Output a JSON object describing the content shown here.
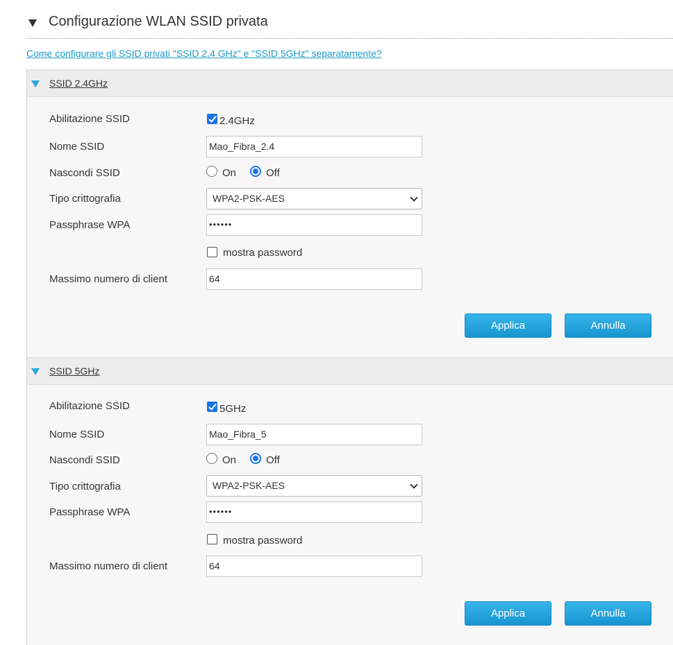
{
  "page": {
    "title": "Configurazione WLAN SSID privata",
    "help_link": "Come configurare gli SSID privati \"SSID 2.4 GHz\" e \"SSID 5GHz\" separatamente?"
  },
  "labels": {
    "enable": "Abilitazione SSID",
    "name": "Nome SSID",
    "hide": "Nascondi SSID",
    "encryption": "Tipo crittografia",
    "passphrase": "Passphrase WPA",
    "show_password": "mostra password",
    "max_clients": "Massimo numero di client",
    "on": "On",
    "off": "Off",
    "apply": "Applica",
    "cancel": "Annulla"
  },
  "ssid24": {
    "title": "SSID 2.4GHz",
    "enabled": true,
    "band_label": "2.4GHz",
    "name": "Mao_Fibra_2.4",
    "hide": "Off",
    "encryption": "WPA2-PSK-AES",
    "passphrase": "••••••",
    "show_password": false,
    "max_clients": "64"
  },
  "ssid5": {
    "title": "SSID 5GHz",
    "enabled": true,
    "band_label": "5GHz",
    "name": "Mao_Fibra_5",
    "hide": "Off",
    "encryption": "WPA2-PSK-AES",
    "passphrase": "••••••",
    "show_password": false,
    "max_clients": "64"
  },
  "icons": {
    "section": "collapse-triangle-icon",
    "panel": "expand-triangle-icon",
    "select": "chevron-down-icon"
  },
  "colors": {
    "link": "#1a9ac9",
    "accent": "#2aa7dc",
    "button": "#1a9ed6",
    "checkbox": "#1a73e8"
  }
}
